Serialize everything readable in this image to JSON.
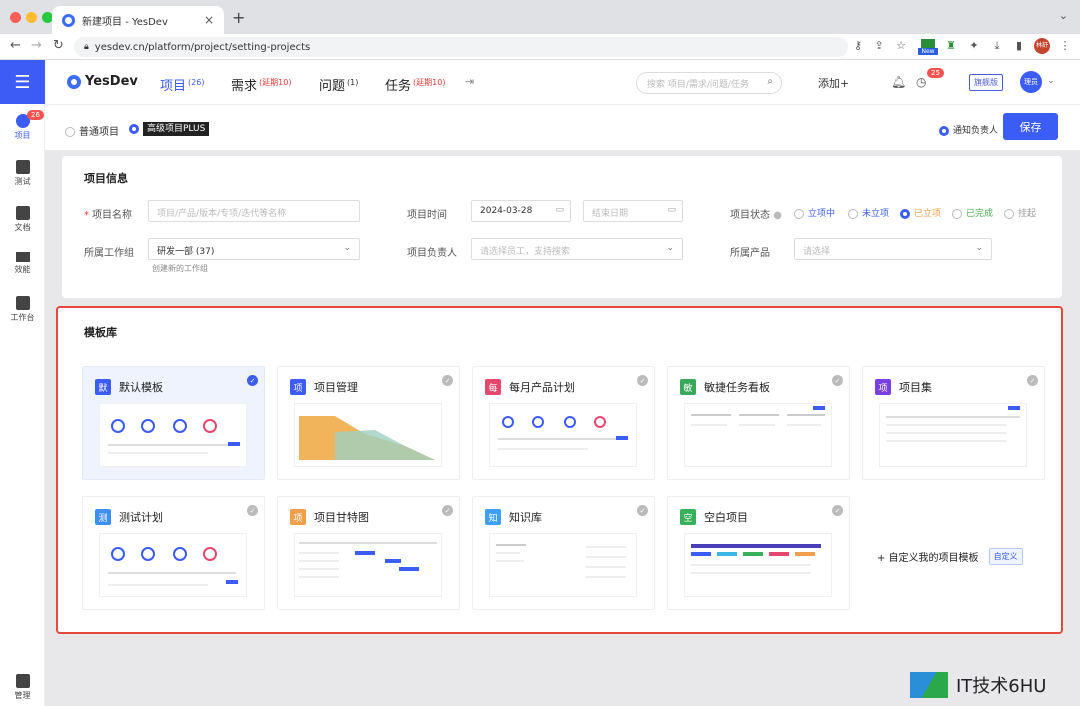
{
  "browser": {
    "tab_title": "新建项目 - YesDev",
    "url": "yesdev.cn/platform/project/setting-projects",
    "ext_new": "New",
    "profile": "林舒"
  },
  "sidebar": {
    "items": [
      {
        "label": "项目",
        "badge": "26"
      },
      {
        "label": "测试"
      },
      {
        "label": "文档"
      },
      {
        "label": "效能"
      },
      {
        "label": "工作台"
      }
    ],
    "bottom": {
      "label": "管理"
    }
  },
  "header": {
    "logo": "YesDev",
    "nav": [
      {
        "label": "项目",
        "sup": "(26)"
      },
      {
        "label": "需求",
        "sup": "(延期10)"
      },
      {
        "label": "问题",
        "sup": "(1)"
      },
      {
        "label": "任务",
        "sup": "(延期10)"
      }
    ],
    "search_placeholder": "搜索 项目/需求/问题/任务",
    "add_label": "添加+",
    "notif_badge": "25",
    "flag": "旗舰版",
    "user": "理员"
  },
  "project_type": {
    "normal": "普通项目",
    "advanced": "高级项目PLUS",
    "notify": "通知负责人",
    "save": "保存"
  },
  "info": {
    "title": "项目信息",
    "name_label": "项目名称",
    "name_placeholder": "项目/产品/版本/专项/迭代等名称",
    "time_label": "项目时间",
    "start_date": "2024-03-28",
    "end_placeholder": "结束日期",
    "status_label": "项目状态",
    "status_options": [
      "立项中",
      "未立项",
      "已立项",
      "已完成",
      "挂起"
    ],
    "group_label": "所属工作组",
    "group_value": "研发一部 (37)",
    "group_link": "创建新的工作组",
    "owner_label": "项目负责人",
    "owner_placeholder": "请选择员工，支持搜索",
    "product_label": "所属产品",
    "product_placeholder": "请选择"
  },
  "templates": {
    "title": "模板库",
    "cards": [
      {
        "icon": "默",
        "name": "默认模板",
        "color": "#3b5cf5"
      },
      {
        "icon": "项",
        "name": "项目管理",
        "color": "#3b5cf5"
      },
      {
        "icon": "每",
        "name": "每月产品计划",
        "color": "#e5486e"
      },
      {
        "icon": "敏",
        "name": "敏捷任务看板",
        "color": "#3aa85a"
      },
      {
        "icon": "项",
        "name": "项目集",
        "color": "#7b3ee0"
      },
      {
        "icon": "测",
        "name": "测试计划",
        "color": "#3d8ef5"
      },
      {
        "icon": "项",
        "name": "项目甘特图",
        "color": "#f0a04a"
      },
      {
        "icon": "知",
        "name": "知识库",
        "color": "#3d9ff5"
      },
      {
        "icon": "空",
        "name": "空白项目",
        "color": "#37b05a"
      }
    ],
    "custom_label": "+ 自定义我的项目模板",
    "custom_tag": "自定义"
  },
  "watermark": "IT技术6HU"
}
